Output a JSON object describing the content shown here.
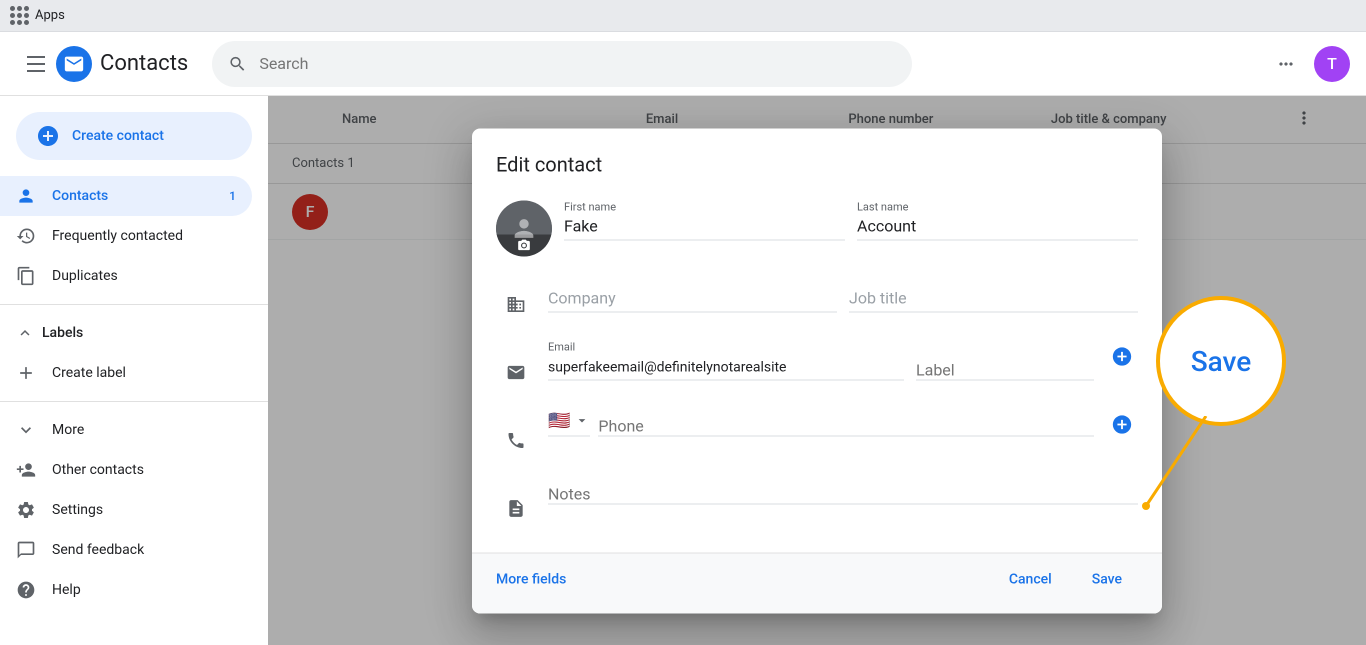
{
  "appbar": {
    "apps_label": "Apps"
  },
  "header": {
    "menu_label": "Menu",
    "logo_letter": "C",
    "title": "Contacts",
    "search_placeholder": "Search",
    "avatar_letter": "T"
  },
  "sidebar": {
    "create_btn_label": "Create contact",
    "nav_items": [
      {
        "id": "contacts",
        "label": "Contacts",
        "badge": "1",
        "active": true,
        "icon": "person"
      },
      {
        "id": "frequently",
        "label": "Frequently contacted",
        "active": false,
        "icon": "history"
      },
      {
        "id": "duplicates",
        "label": "Duplicates",
        "active": false,
        "icon": "copy"
      }
    ],
    "labels_section": "Labels",
    "create_label": "Create label",
    "more_item": "More",
    "other_contacts_item": "Other contacts",
    "settings_item": "Settings",
    "send_feedback_item": "Send feedback",
    "help_item": "Help"
  },
  "table": {
    "col_name": "Name",
    "col_email": "Email",
    "col_phone": "Phone number",
    "col_job": "Job title & company",
    "contact_count_label": "Contacts",
    "contact_count": "1"
  },
  "dialog": {
    "title": "Edit contact",
    "avatar_camera_icon": "📷",
    "first_name_label": "First name",
    "first_name_value": "Fake",
    "last_name_label": "Last name",
    "last_name_value": "Account",
    "company_placeholder": "Company",
    "job_title_placeholder": "Job title",
    "email_label": "Email",
    "email_value": "superfakeemail@definitelynotarealsite",
    "label_placeholder": "Label",
    "phone_flag": "🇺🇸",
    "phone_placeholder": "Phone",
    "notes_placeholder": "Notes",
    "more_fields_label": "More fields",
    "cancel_label": "Cancel",
    "save_label": "Save"
  },
  "annotation": {
    "save_label": "Save"
  },
  "contact_row": {
    "initial": "F",
    "bg_color": "#d93025"
  }
}
